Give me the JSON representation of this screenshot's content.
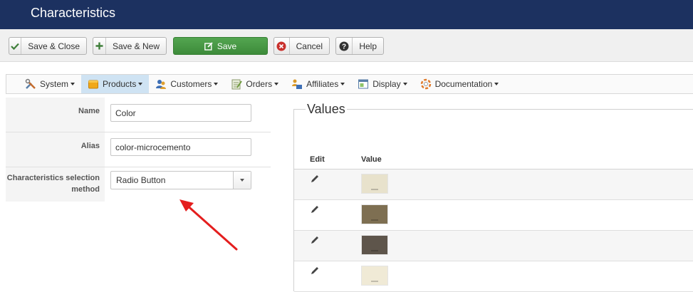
{
  "header": {
    "title": "Characteristics"
  },
  "toolbar": {
    "save_close_label": "Save & Close",
    "save_new_label": "Save & New",
    "save_label": "Save",
    "cancel_label": "Cancel",
    "help_label": "Help"
  },
  "menu": {
    "items": [
      {
        "label": "System",
        "icon": "tools-icon"
      },
      {
        "label": "Products",
        "icon": "products-icon"
      },
      {
        "label": "Customers",
        "icon": "customers-icon"
      },
      {
        "label": "Orders",
        "icon": "orders-icon"
      },
      {
        "label": "Affiliates",
        "icon": "affiliates-icon"
      },
      {
        "label": "Display",
        "icon": "display-icon"
      },
      {
        "label": "Documentation",
        "icon": "documentation-icon"
      }
    ],
    "active": "Products"
  },
  "form": {
    "name_label": "Name",
    "name_value": "Color",
    "alias_label": "Alias",
    "alias_value": "color-microcemento",
    "method_label": "Characteristics selection method",
    "method_value": "Radio Button"
  },
  "values_panel": {
    "legend": "Values",
    "col_edit": "Edit",
    "col_value": "Value",
    "rows": [
      {
        "color": "#e8e2cc"
      },
      {
        "color": "#7e6f52"
      },
      {
        "color": "#5e554b"
      },
      {
        "color": "#f0ead6"
      }
    ]
  },
  "colors": {
    "header_bg": "#1c3160",
    "save_green": "#3d8b3a",
    "active_menu": "#cfe3f3",
    "annotation_arrow": "#e41e1e"
  }
}
